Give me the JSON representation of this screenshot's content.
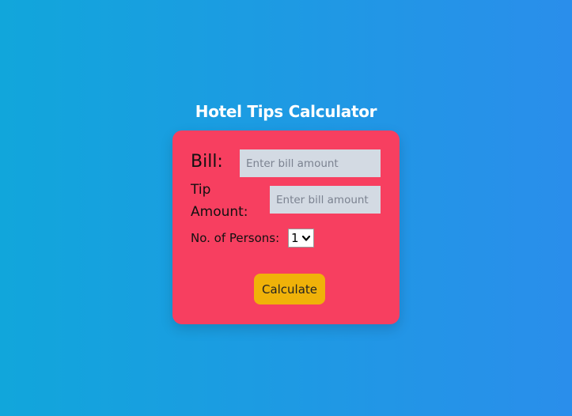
{
  "page": {
    "title": "Hotel Tips Calculator"
  },
  "form": {
    "bill_label": "Bill:",
    "bill_placeholder": "Enter bill amount",
    "tip_label_line1": "Tip",
    "tip_label_line2": "Amount:",
    "tip_placeholder": "Enter bill amount",
    "persons_label": "No. of Persons:",
    "persons_selected": "1",
    "calculate_label": "Calculate"
  },
  "colors": {
    "background_start": "#11a6db",
    "background_end": "#2a8eeb",
    "card": "#f73f60",
    "input_bg": "#d3dae3",
    "button": "#f0b209"
  },
  "icons": {
    "select_arrow": "chevron-down-icon"
  }
}
